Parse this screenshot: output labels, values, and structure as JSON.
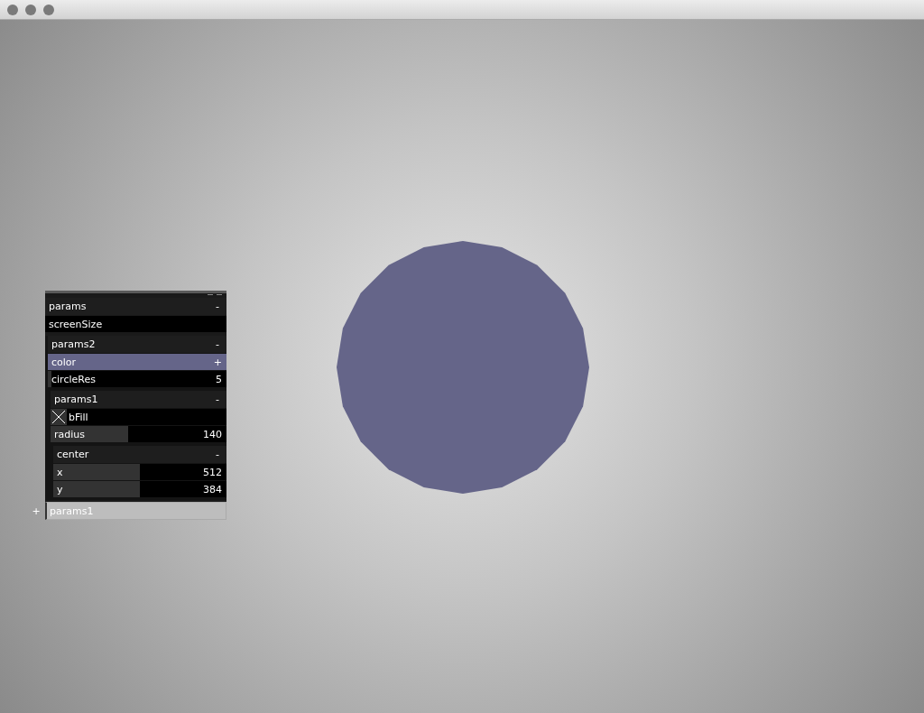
{
  "panel": {
    "title": "params",
    "toggle": "-",
    "items": [
      {
        "kind": "label",
        "label": "screenSize"
      },
      {
        "kind": "group",
        "label": "params2",
        "toggle": "-",
        "children": [
          {
            "kind": "color",
            "label": "color",
            "toggle": "+",
            "color": "#656589"
          },
          {
            "kind": "slider",
            "label": "circleRes",
            "value": "5",
            "level": 0.02
          },
          {
            "kind": "group",
            "label": "params1",
            "toggle": "-",
            "children": [
              {
                "kind": "toggle",
                "label": "bFill",
                "checked": true
              },
              {
                "kind": "slider",
                "label": "radius",
                "value": "140",
                "level": 0.44
              },
              {
                "kind": "group",
                "label": "center",
                "toggle": "-",
                "children": [
                  {
                    "kind": "slider",
                    "label": "x",
                    "value": "512",
                    "level": 0.5
                  },
                  {
                    "kind": "slider",
                    "label": "y",
                    "value": "384",
                    "level": 0.5
                  }
                ]
              }
            ]
          }
        ]
      }
    ]
  },
  "name_field": {
    "prefix": "+",
    "value": "params1"
  }
}
